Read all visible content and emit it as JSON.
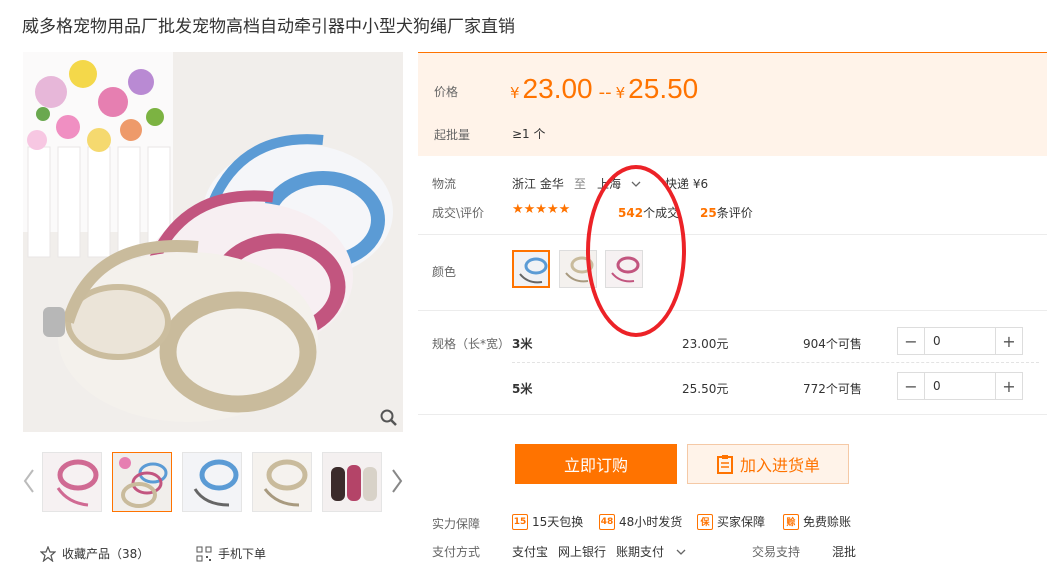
{
  "product": {
    "title": "威多格宠物用品厂批发宠物高档自动牵引器中小型犬狗绳厂家直销"
  },
  "price": {
    "label": "价格",
    "currency": "¥",
    "low": "23.00",
    "separator": "--",
    "high": "25.50",
    "moq_label": "起批量",
    "moq_value": "≥1 个"
  },
  "logistics": {
    "label": "物流",
    "from": "浙江 金华",
    "to_word": "至",
    "destination": "上海",
    "shipping": "快递 ¥6"
  },
  "deals": {
    "label": "成交\\评价",
    "stars": "★★★★★",
    "rating": 5,
    "count": "542",
    "count_suffix": "个成交",
    "reviews": "25",
    "reviews_suffix": "条评价"
  },
  "color": {
    "label": "颜色",
    "options": [
      "blue",
      "grey",
      "pink"
    ]
  },
  "spec": {
    "label": "规格（长*宽）",
    "rows": [
      {
        "name": "3米",
        "price": "23.00元",
        "stock": "904个可售",
        "qty": "0"
      },
      {
        "name": "5米",
        "price": "25.50元",
        "stock": "772个可售",
        "qty": "0"
      }
    ]
  },
  "actions": {
    "buy": "立即订购",
    "cart": "加入进货单"
  },
  "guarantee": {
    "label": "实力保障",
    "items": [
      {
        "icon": "15",
        "text": "15天包换"
      },
      {
        "icon": "48",
        "text": "48小时发货"
      },
      {
        "icon": "保",
        "text": "买家保障"
      },
      {
        "icon": "赊",
        "text": "免费赊账"
      }
    ]
  },
  "payment": {
    "label": "支付方式",
    "methods": [
      "支付宝",
      "网上银行",
      "账期支付"
    ],
    "trade_label": "交易支持",
    "trade_value": "混批"
  },
  "gallery": {
    "favorite": "收藏产品（38）",
    "mobile": "手机下单"
  },
  "colors": {
    "accent": "#ff7300",
    "price_bg": "#fff3e9",
    "annotation": "#ec2227"
  }
}
